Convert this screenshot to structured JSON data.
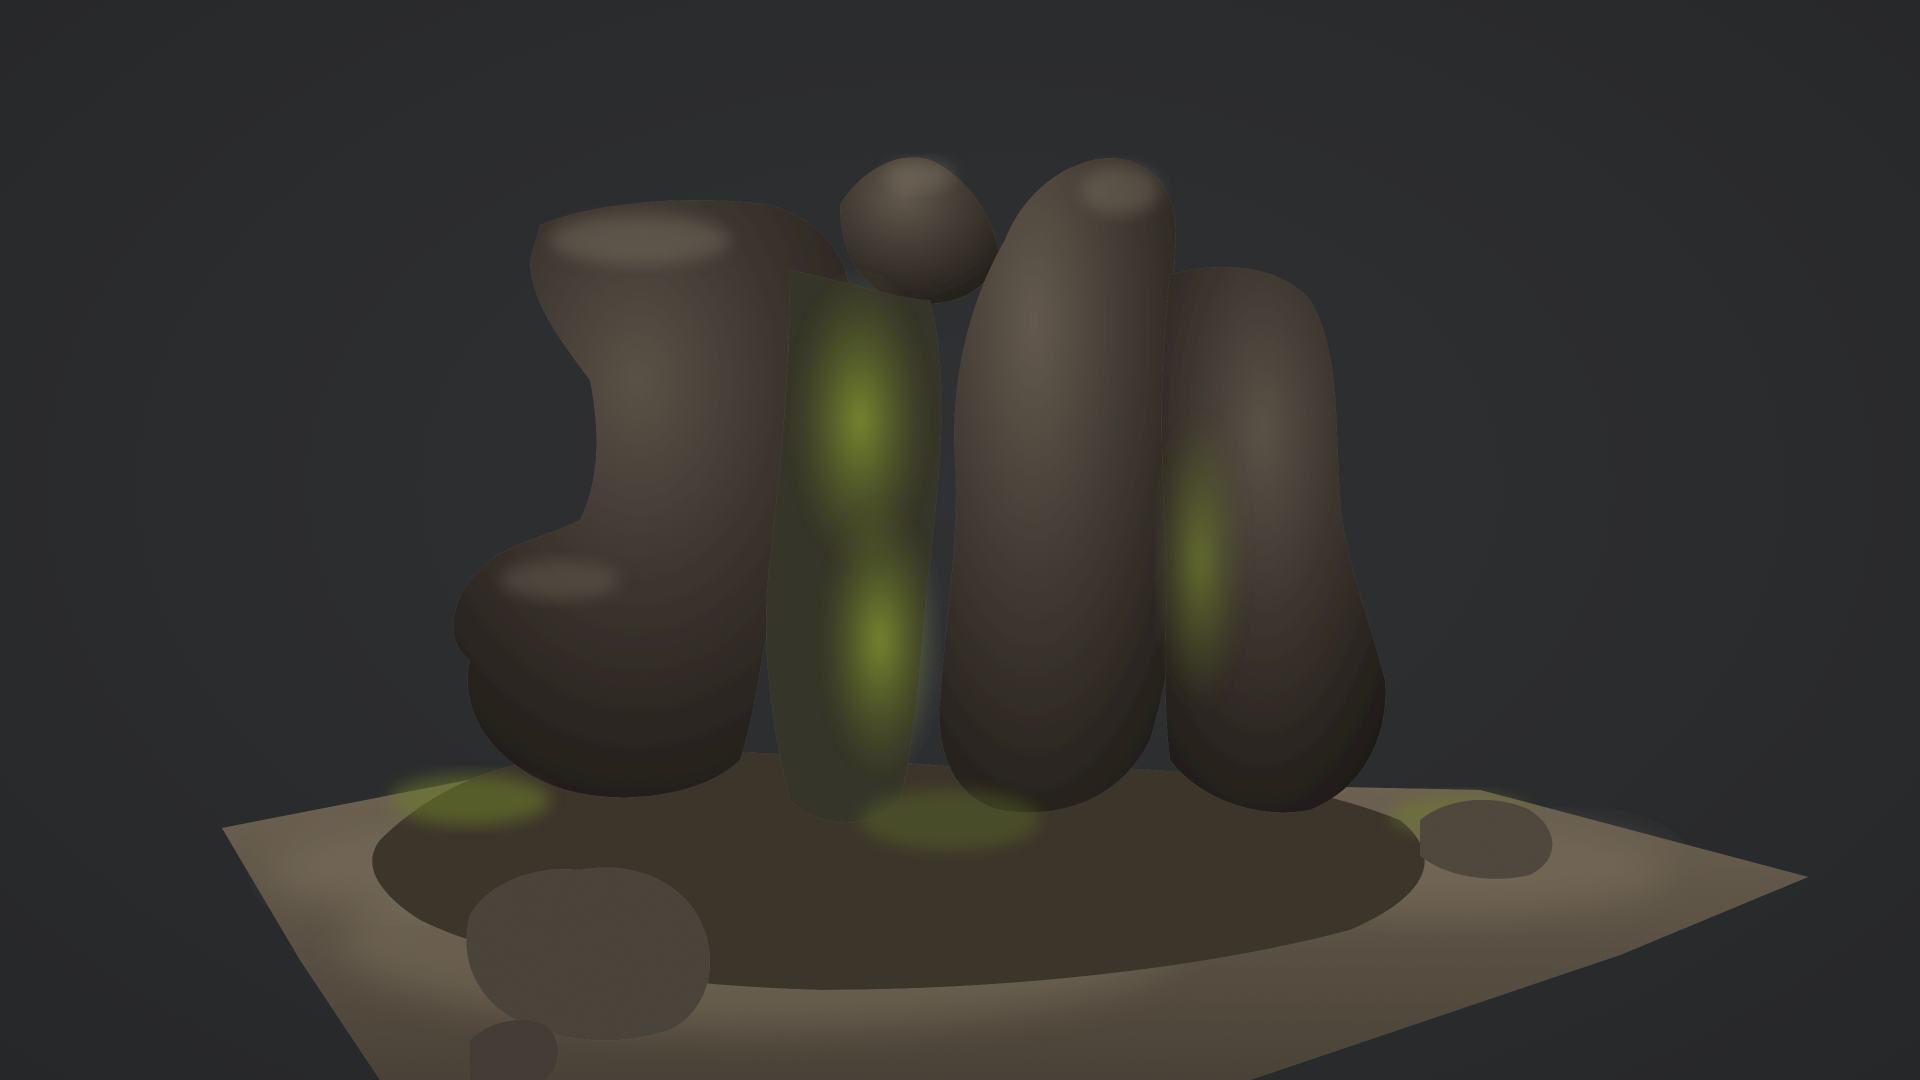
{
  "scene": {
    "subject": "rock-formation-3d-model",
    "colors": {
      "background": "#2a2b2d",
      "rock_dark": "#2e2a25",
      "rock_mid": "#4d463d",
      "rock_light": "#7a7063",
      "moss": "#6b7a2a",
      "moss_light": "#8a9a3a",
      "ground": "#5c5347",
      "ground_light": "#8a7e6c"
    }
  }
}
